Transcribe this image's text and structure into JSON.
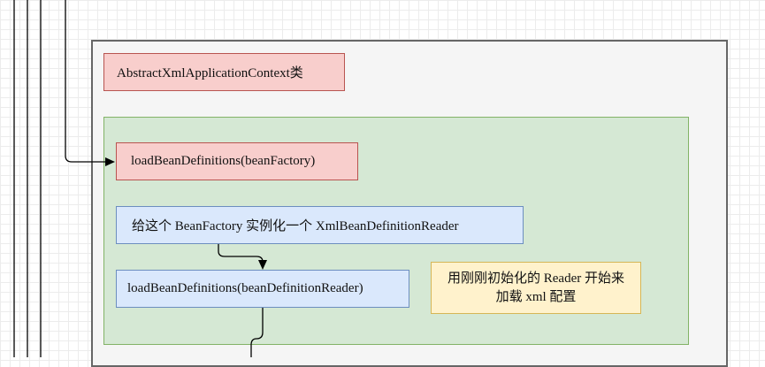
{
  "diagram": {
    "class_title": "AbstractXmlApplicationContext类",
    "step_load_bean_definitions": "loadBeanDefinitions(beanFactory)",
    "step_create_reader": "给这个 BeanFactory 实例化一个 XmlBeanDefinitionReader",
    "step_load_with_reader": "loadBeanDefinitions(beanDefinitionReader)",
    "note_line1": "用刚刚初始化的 Reader 开始来",
    "note_line2": "加载 xml 配置"
  },
  "colors": {
    "red_fill": "#f8cecc",
    "red_stroke": "#b85450",
    "blue_fill": "#dae8fc",
    "blue_stroke": "#6c8ebf",
    "green_fill": "#d5e8d4",
    "green_stroke": "#82b366",
    "yellow_fill": "#fff2cc",
    "yellow_stroke": "#d6b656"
  }
}
